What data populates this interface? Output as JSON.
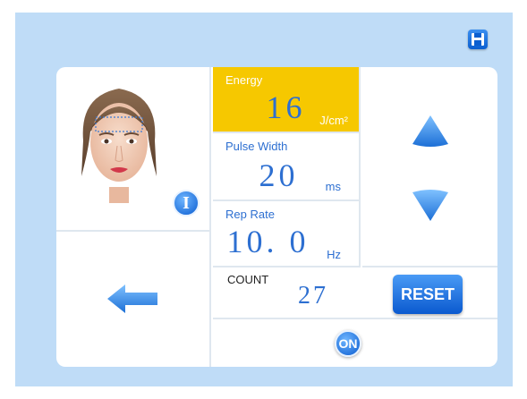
{
  "parameters": {
    "energy": {
      "label": "Energy",
      "value": "16",
      "unit": "J/cm²"
    },
    "pulse_width": {
      "label": "Pulse Width",
      "value": "20",
      "unit": "ms"
    },
    "rep_rate": {
      "label": "Rep Rate",
      "value": "10. 0",
      "unit": "Hz"
    }
  },
  "counter": {
    "label": "COUNT",
    "value": "27",
    "reset_label": "RESET"
  },
  "controls": {
    "on_label": "ON",
    "info_label": "I"
  },
  "icons": {
    "save": "save-icon",
    "face": "face-treatment-area-image",
    "back": "arrow-left-icon",
    "up": "triangle-up-icon",
    "down": "triangle-down-icon"
  },
  "colors": {
    "background": "#bfdcf7",
    "accent": "#2d6fd1",
    "selected": "#f6c800"
  }
}
